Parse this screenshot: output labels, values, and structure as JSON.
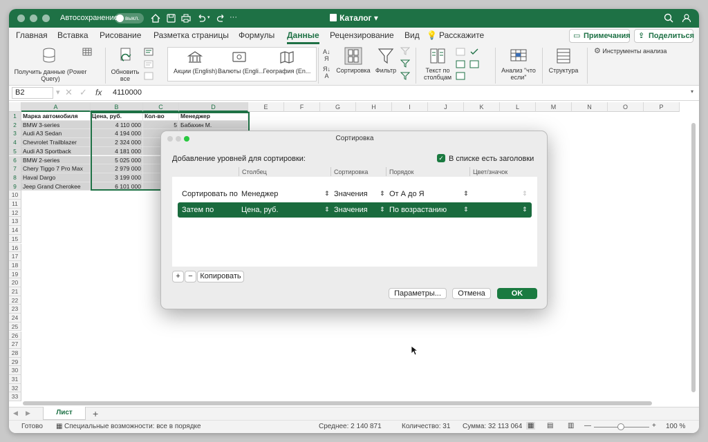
{
  "titlebar": {
    "autosave_label": "Автосохранение",
    "toggle_label": "выкл.",
    "document_title": "Каталог"
  },
  "menu": {
    "tabs": [
      "Главная",
      "Вставка",
      "Рисование",
      "Разметка страницы",
      "Формулы",
      "Данные",
      "Рецензирование",
      "Вид",
      "Расскажите"
    ],
    "active_tab": "Данные",
    "comments_button": "Примечания",
    "share_button": "Поделиться"
  },
  "ribbon": {
    "get_data": "Получить данные (Power Query)",
    "refresh_all": "Обновить все",
    "data_types": [
      "Акции (English)",
      "Валюты (Engli...",
      "География (En..."
    ],
    "sort": "Сортировка",
    "filter": "Фильтр",
    "text_to_columns": "Текст по столбцам",
    "what_if": "Анализ \"что если\"",
    "outline": "Структура",
    "analysis_tools": "Инструменты анализа"
  },
  "formula_bar": {
    "name_box": "B2",
    "fx": "fx",
    "value": "4110000"
  },
  "grid": {
    "columns": [
      "A",
      "B",
      "C",
      "D",
      "E",
      "F",
      "G",
      "H",
      "I",
      "J",
      "K",
      "L",
      "M",
      "N",
      "O",
      "P"
    ],
    "row_count": 33,
    "headers": [
      "Марка автомобиля",
      "Цена, руб.",
      "Кол-во",
      "Менеджер"
    ],
    "rows": [
      [
        "BMW 3-series",
        "4 110 000",
        "5",
        "Бабахин М."
      ],
      [
        "Audi A3 Sedan",
        "4 194 000",
        "",
        ""
      ],
      [
        "Chevrolet Trailblazer",
        "2 324 000",
        "",
        ""
      ],
      [
        "Audi A3 Sportback",
        "4 181 000",
        "",
        ""
      ],
      [
        "BMW 2-series",
        "5 025 000",
        "",
        ""
      ],
      [
        "Chery Tiggo 7 Pro Max",
        "2 979 000",
        "",
        ""
      ],
      [
        "Haval Dargo",
        "3 199 000",
        "",
        ""
      ],
      [
        "Jeep Grand Cherokee",
        "6 101 000",
        "",
        ""
      ]
    ]
  },
  "sheet": {
    "tab": "Лист",
    "add": "+"
  },
  "status": {
    "ready": "Готово",
    "accessibility": "Специальные возможности: все в порядке",
    "average": "Среднее: 2 140 871",
    "count": "Количество: 31",
    "sum": "Сумма: 32 113 064",
    "zoom": "100 %"
  },
  "dialog": {
    "title": "Сортировка",
    "add_level_label": "Добавление уровней для сортировки:",
    "headers_checkbox": "В списке есть заголовки",
    "col_column": "Столбец",
    "col_sort": "Сортировка",
    "col_order": "Порядок",
    "col_color": "Цвет/значок",
    "levels": [
      {
        "label": "Сортировать по",
        "column": "Менеджер",
        "sort_on": "Значения",
        "order": "От А до Я"
      },
      {
        "label": "Затем по",
        "column": "Цена, руб.",
        "sort_on": "Значения",
        "order": "По возрастанию"
      }
    ],
    "copy_button": "Копировать",
    "params_button": "Параметры...",
    "cancel_button": "Отмена",
    "ok_button": "OK"
  }
}
